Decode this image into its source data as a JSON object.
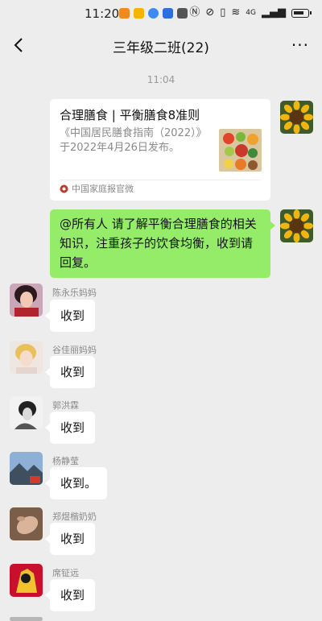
{
  "status_bar": {
    "time": "11:20",
    "network": "4G"
  },
  "nav": {
    "title": "三年级二班(22)",
    "more_label": "···"
  },
  "timestamp": "11:04",
  "shared_article": {
    "title": "合理膳食 | 平衡膳食8准则",
    "description": "《中国居民膳食指南（2022）》于2022年4月26日发布。",
    "source": "中国家庭报官微"
  },
  "my_message": {
    "text": "@所有人  请了解平衡合理膳食的相关知识，注重孩子的饮食均衡，收到请回复。"
  },
  "messages": [
    {
      "sender": "陈永乐妈妈",
      "text": "收到"
    },
    {
      "sender": "谷佳丽妈妈",
      "text": "收到"
    },
    {
      "sender": "郭洪霖",
      "text": "收到"
    },
    {
      "sender": "杨静莹",
      "text": "收到。"
    },
    {
      "sender": "郑煜楷奶奶",
      "text": "收到"
    },
    {
      "sender": "席钲远",
      "text": "收到"
    }
  ],
  "colors": {
    "background": "#ededed",
    "my_bubble": "#95ec69",
    "incoming_bubble": "#ffffff"
  }
}
